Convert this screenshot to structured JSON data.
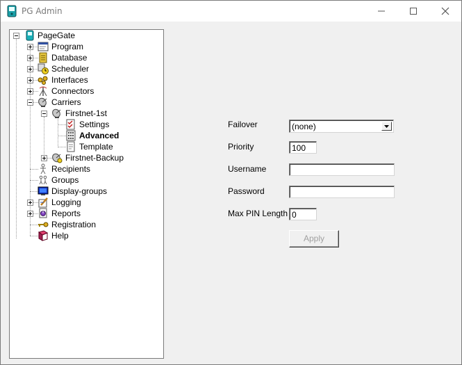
{
  "window": {
    "title": "PG Admin"
  },
  "tree": {
    "root": "PageGate",
    "items": {
      "program": "Program",
      "database": "Database",
      "scheduler": "Scheduler",
      "interfaces": "Interfaces",
      "connectors": "Connectors",
      "carriers": "Carriers",
      "firstnet1": "Firstnet-1st",
      "settings": "Settings",
      "advanced": "Advanced",
      "template": "Template",
      "firstnetBackup": "Firstnet-Backup",
      "recipients": "Recipients",
      "groups": "Groups",
      "displayGroups": "Display-groups",
      "logging": "Logging",
      "reports": "Reports",
      "registration": "Registration",
      "help": "Help"
    },
    "selected": "advanced"
  },
  "form": {
    "failover": {
      "label": "Failover",
      "value": "(none)"
    },
    "priority": {
      "label": "Priority",
      "value": "100"
    },
    "username": {
      "label": "Username",
      "value": ""
    },
    "password": {
      "label": "Password",
      "value": ""
    },
    "maxPin": {
      "label": "Max PIN Length",
      "value": "0"
    },
    "apply": "Apply"
  }
}
